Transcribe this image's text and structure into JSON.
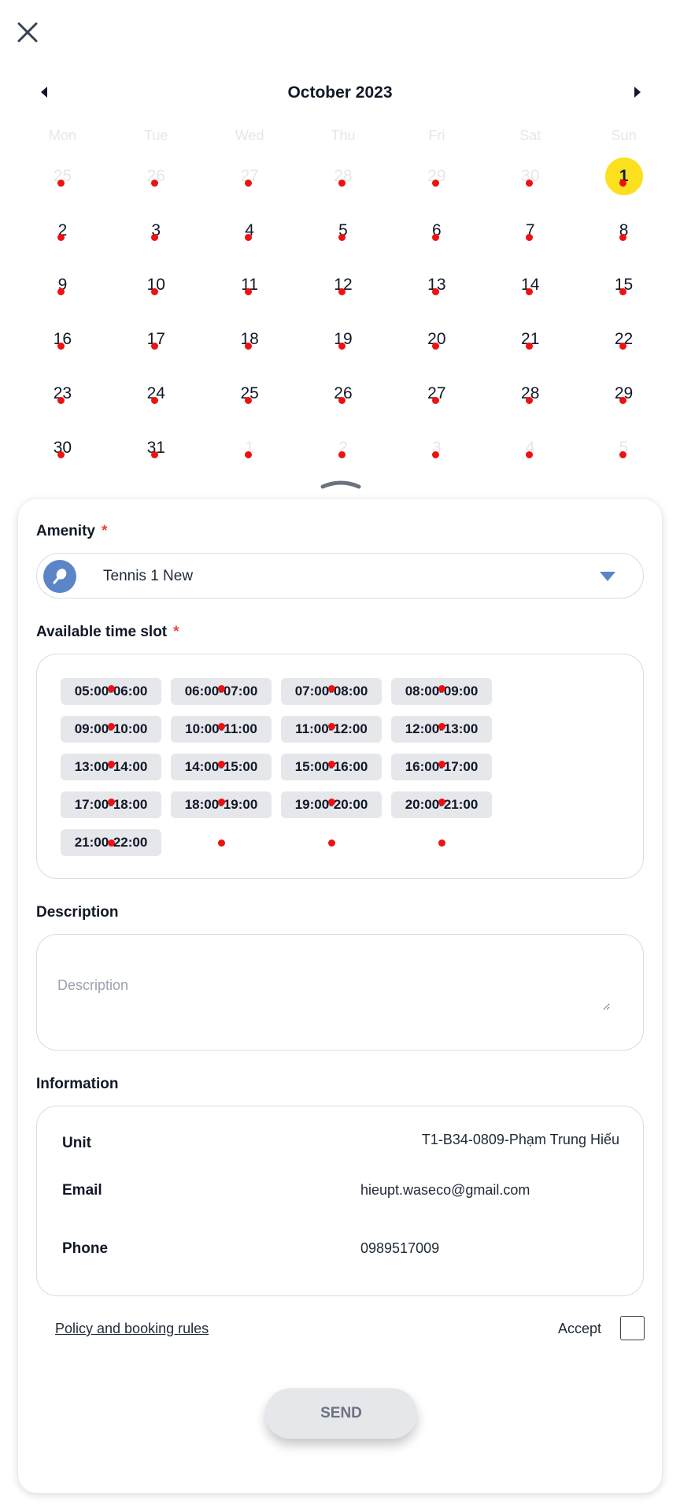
{
  "calendar": {
    "month_title": "October 2023",
    "weekdays": [
      "Mon",
      "Tue",
      "Wed",
      "Thu",
      "Fri",
      "Sat",
      "Sun"
    ],
    "days": [
      {
        "label": "25",
        "muted": true
      },
      {
        "label": "26",
        "muted": true
      },
      {
        "label": "27",
        "muted": true
      },
      {
        "label": "28",
        "muted": true
      },
      {
        "label": "29",
        "muted": true
      },
      {
        "label": "30",
        "muted": true
      },
      {
        "label": "1",
        "muted": false,
        "selected": true
      },
      {
        "label": "2"
      },
      {
        "label": "3"
      },
      {
        "label": "4"
      },
      {
        "label": "5"
      },
      {
        "label": "6"
      },
      {
        "label": "7"
      },
      {
        "label": "8"
      },
      {
        "label": "9"
      },
      {
        "label": "10"
      },
      {
        "label": "11"
      },
      {
        "label": "12"
      },
      {
        "label": "13"
      },
      {
        "label": "14"
      },
      {
        "label": "15"
      },
      {
        "label": "16"
      },
      {
        "label": "17"
      },
      {
        "label": "18"
      },
      {
        "label": "19"
      },
      {
        "label": "20"
      },
      {
        "label": "21"
      },
      {
        "label": "22"
      },
      {
        "label": "23"
      },
      {
        "label": "24"
      },
      {
        "label": "25"
      },
      {
        "label": "26"
      },
      {
        "label": "27"
      },
      {
        "label": "28"
      },
      {
        "label": "29"
      },
      {
        "label": "30"
      },
      {
        "label": "31"
      },
      {
        "label": "1",
        "muted": true
      },
      {
        "label": "2",
        "muted": true
      },
      {
        "label": "3",
        "muted": true
      },
      {
        "label": "4",
        "muted": true
      },
      {
        "label": "5",
        "muted": true
      }
    ],
    "selected_color": "#fbe020",
    "dot_color": "#ee1111"
  },
  "amenity": {
    "label": "Amenity",
    "required_mark": "*",
    "value": "Tennis 1 New",
    "icon": "tennis-racket-icon",
    "icon_color": "#5b85c7"
  },
  "timeslot": {
    "label": "Available time slot",
    "required_mark": "*",
    "slots": [
      "05:00-06:00",
      "06:00-07:00",
      "07:00-08:00",
      "08:00-09:00",
      "09:00-10:00",
      "10:00-11:00",
      "11:00-12:00",
      "12:00-13:00",
      "13:00-14:00",
      "14:00-15:00",
      "15:00-16:00",
      "16:00-17:00",
      "17:00-18:00",
      "18:00-19:00",
      "19:00-20:00",
      "20:00-21:00",
      "21:00-22:00"
    ]
  },
  "description": {
    "label": "Description",
    "placeholder": "Description",
    "value": ""
  },
  "information": {
    "label": "Information",
    "unit_label": "Unit",
    "unit_value": "T1-B34-0809-Phạm Trung Hiếu",
    "email_label": "Email",
    "email_value": "hieupt.waseco@gmail.com",
    "phone_label": "Phone",
    "phone_value": "0989517009"
  },
  "footer": {
    "policy_link": "Policy and booking rules",
    "accept_label": "Accept",
    "send_label": "SEND"
  }
}
